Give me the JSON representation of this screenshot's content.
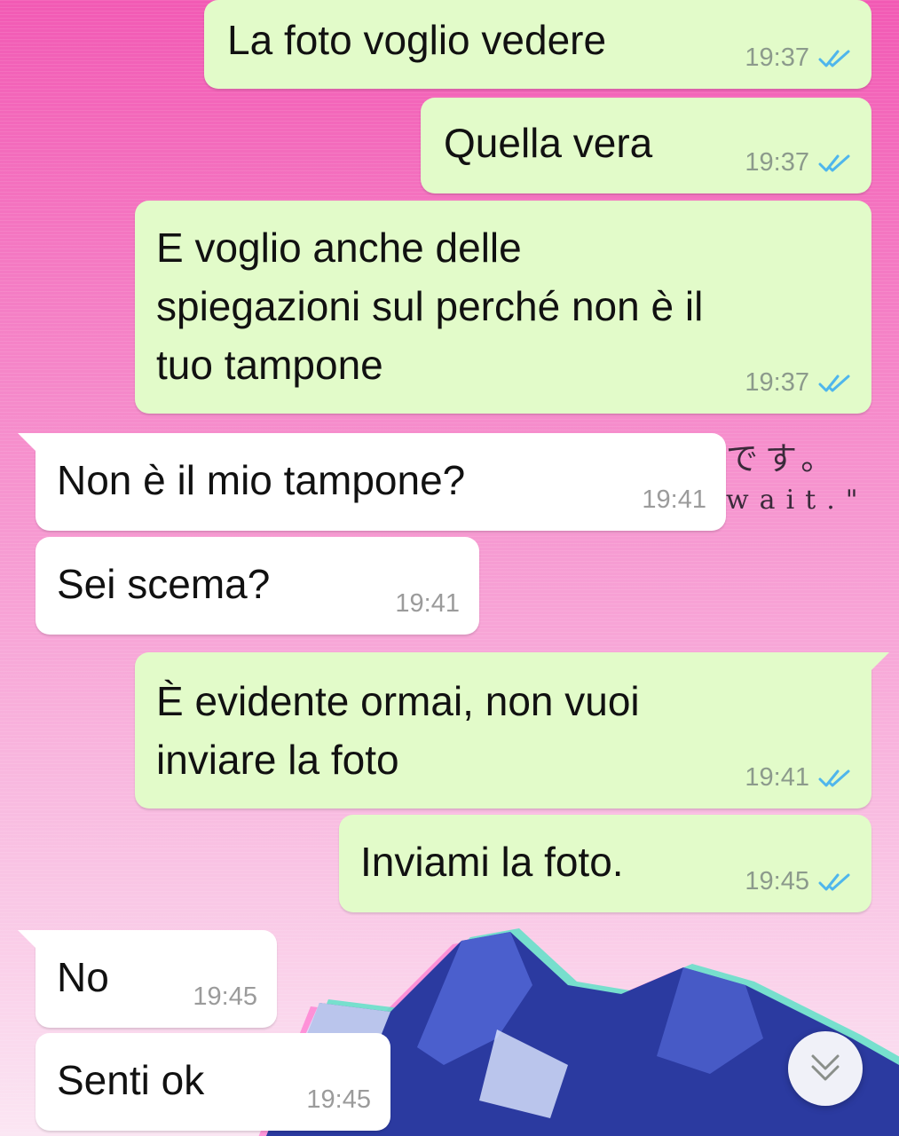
{
  "chat": {
    "messages": [
      {
        "direction": "outgoing",
        "text": "La foto voglio vedere",
        "time": "19:37",
        "status": "read"
      },
      {
        "direction": "outgoing",
        "text": "Quella vera",
        "time": "19:37",
        "status": "read"
      },
      {
        "direction": "outgoing",
        "text": "E voglio anche delle\nspiegazioni sul perché non è il\ntuo tampone",
        "time": "19:37",
        "status": "read"
      },
      {
        "direction": "incoming",
        "text": "Non è il mio tampone?",
        "time": "19:41"
      },
      {
        "direction": "incoming",
        "text": "Sei scema?",
        "time": "19:41"
      },
      {
        "direction": "outgoing",
        "text": "È evidente ormai, non vuoi\ninviare la foto",
        "time": "19:41",
        "status": "read"
      },
      {
        "direction": "outgoing",
        "text": "Inviami la foto.",
        "time": "19:45",
        "status": "read"
      },
      {
        "direction": "incoming",
        "text": "No",
        "time": "19:45"
      },
      {
        "direction": "incoming",
        "text": "Senti ok",
        "time": "19:45"
      }
    ]
  },
  "wallpaper": {
    "line1": "です。",
    "line2": "wait.\"",
    "colors": {
      "top": "#f25ab4",
      "bottom": "#fbe6f3",
      "mountain": "#2b3aa0",
      "glitch_cyan": "#5fe0c8",
      "glitch_pink": "#ff7ad0"
    }
  },
  "colors": {
    "outgoing_bubble": "#e2fbc9",
    "incoming_bubble": "#ffffff",
    "read_tick": "#4fb6ec"
  },
  "icons": {
    "read_receipt": "double-check-icon",
    "scroll_down": "double-chevron-down-icon"
  }
}
